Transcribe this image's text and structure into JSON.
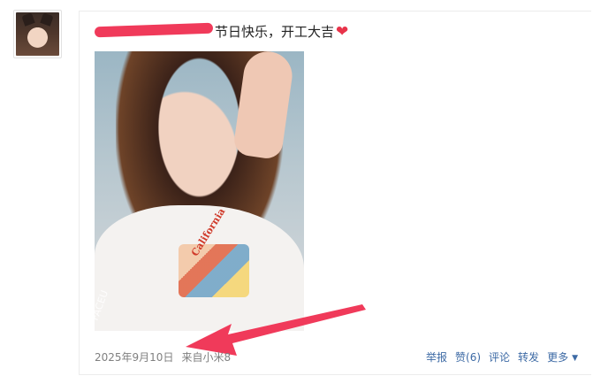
{
  "post": {
    "text_visible": "节日快乐，开工大吉",
    "emoji": "❤",
    "photo_watermark": "FACEU",
    "shirt_print": "California"
  },
  "meta": {
    "date": "2025年9月10日",
    "source": "来自小米8"
  },
  "actions": {
    "report": "举报",
    "like": "赞(6)",
    "comment": "评论",
    "repost": "转发",
    "more": "更多",
    "more_caret": "▼"
  },
  "colors": {
    "link": "#3d6aa5",
    "meta_gray": "#808080",
    "annotation_red": "#f03a5a"
  }
}
